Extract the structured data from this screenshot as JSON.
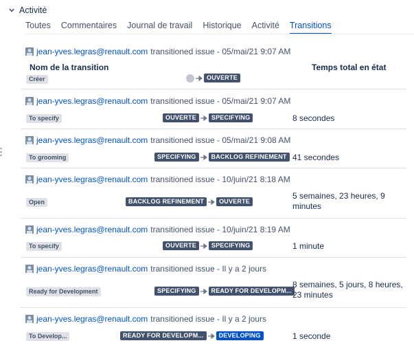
{
  "section": {
    "title": "Activité"
  },
  "tabs": [
    {
      "label": "Toutes"
    },
    {
      "label": "Commentaires"
    },
    {
      "label": "Journal de travail"
    },
    {
      "label": "Historique"
    },
    {
      "label": "Activité"
    },
    {
      "label": "Transitions"
    }
  ],
  "active_tab": "Transitions",
  "columns": {
    "name": "Nom de la transition",
    "time": "Temps total en état"
  },
  "entries": [
    {
      "user": "jean-yves.legras@renault.com",
      "action": "transitioned issue - 05/mai/21 9:07 AM",
      "transition": "Créer",
      "from": "",
      "to": "OUVERTE",
      "duration": ""
    },
    {
      "user": "jean-yves.legras@renault.com",
      "action": "transitioned issue - 05/mai/21 9:07 AM",
      "transition": "To specify",
      "from": "OUVERTE",
      "to": "SPECIFYING",
      "duration": "8 secondes"
    },
    {
      "user": "jean-yves.legras@renault.com",
      "action": "transitioned issue - 05/mai/21 9:08 AM",
      "transition": "To grooming",
      "from": "SPECIFYING",
      "to": "BACKLOG REFINEMENT",
      "duration": "41 secondes"
    },
    {
      "user": "jean-yves.legras@renault.com",
      "action": "transitioned issue - 10/juin/21 8:18 AM",
      "transition": "Open",
      "from": "BACKLOG REFINEMENT",
      "to": "OUVERTE",
      "duration": "5 semaines, 23 heures, 9 minutes"
    },
    {
      "user": "jean-yves.legras@renault.com",
      "action": "transitioned issue - 10/juin/21 8:19 AM",
      "transition": "To specify",
      "from": "OUVERTE",
      "to": "SPECIFYING",
      "duration": "1 minute"
    },
    {
      "user": "jean-yves.legras@renault.com",
      "action": "transitioned issue - Il y a 2 jours",
      "transition": "Ready for Development",
      "from": "SPECIFYING",
      "to": "READY FOR DEVELOPM...",
      "duration": "8 semaines, 5 jours, 8 heures, 23 minutes"
    },
    {
      "user": "jean-yves.legras@renault.com",
      "action": "transitioned issue - Il y a 2 jours",
      "transition": "To Develop...",
      "from": "READY FOR DEVELOPM...",
      "to": "DEVELOPING",
      "duration": "1 seconde"
    }
  ],
  "colors": {
    "link": "#0052cc",
    "status_dark": "#42526e",
    "status_blue": "#0052cc",
    "divider": "#dfe1e6"
  }
}
